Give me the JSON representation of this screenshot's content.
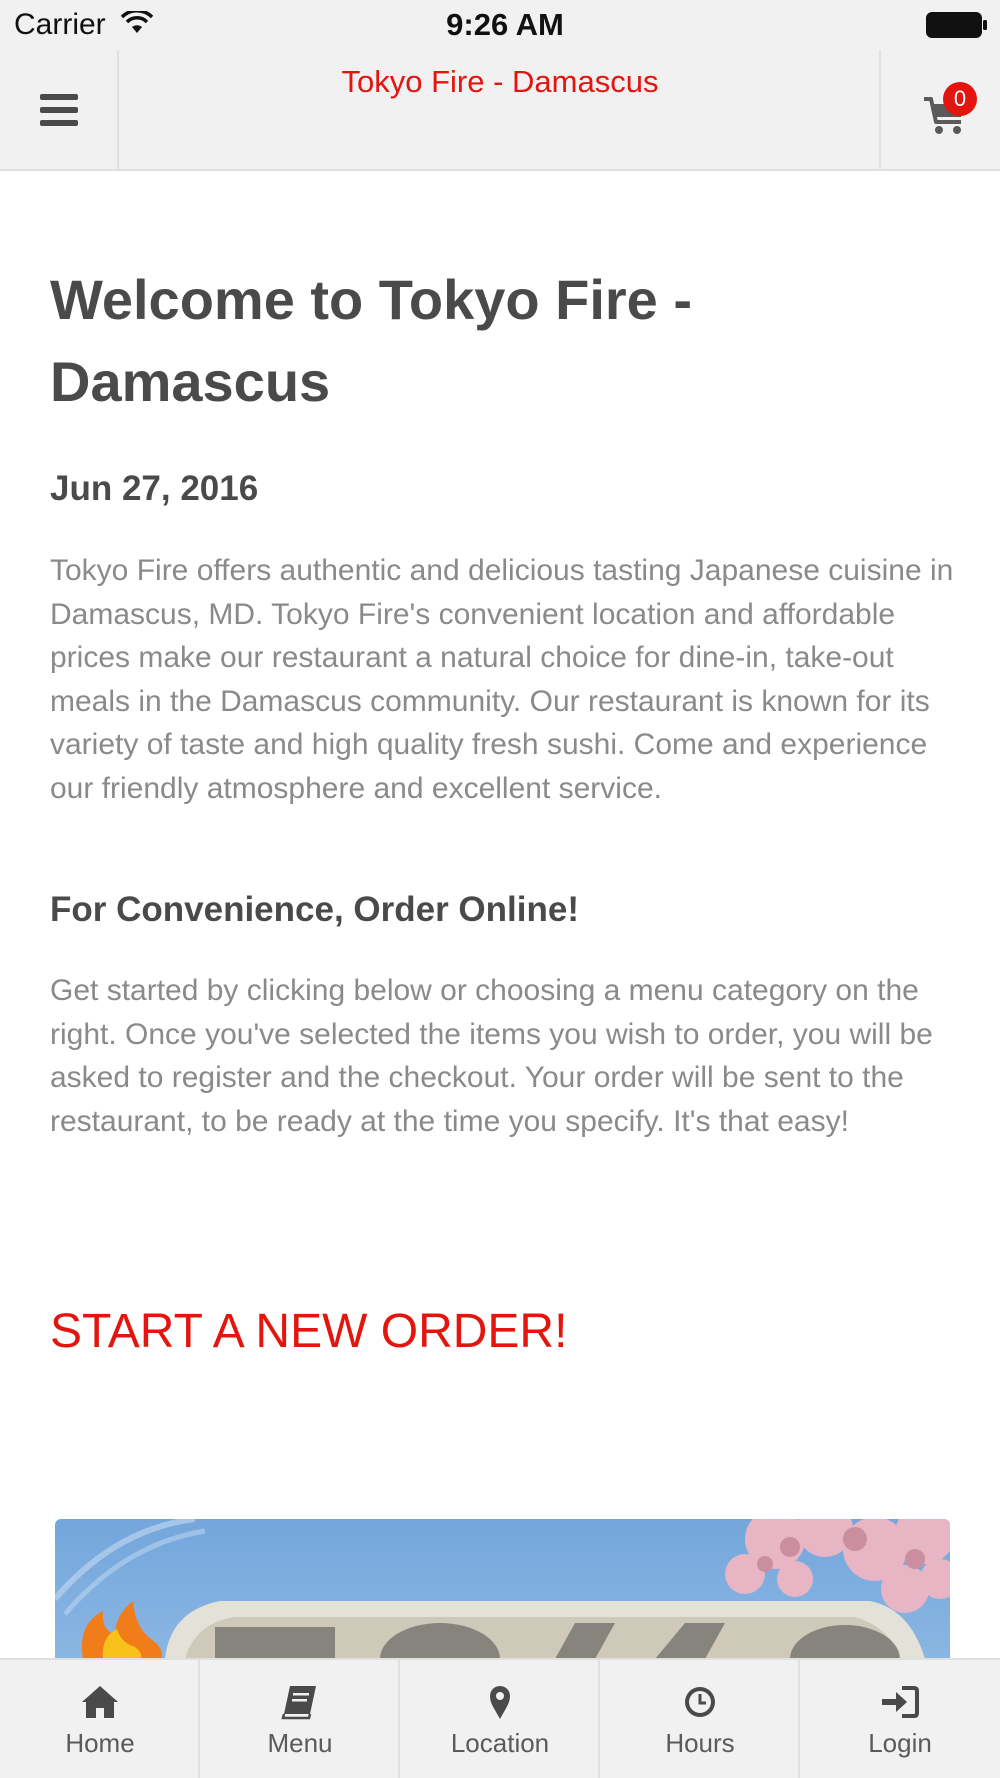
{
  "status_bar": {
    "carrier": "Carrier",
    "time": "9:26 AM"
  },
  "header": {
    "title": "Tokyo Fire - Damascus",
    "cart_count": "0",
    "menu_icon": "hamburger-menu-icon",
    "cart_icon": "shopping-cart-icon"
  },
  "main": {
    "welcome_heading": "Welcome to Tokyo Fire - Damascus",
    "date": "Jun 27, 2016",
    "intro": "Tokyo Fire offers authentic and delicious tasting Japanese cuisine in Damascus, MD. Tokyo Fire's convenient location and affordable prices make our restaurant a natural choice for dine-in, take-out meals in the Damascus community. Our restaurant is known for its variety of taste and high quality fresh sushi. Come and experience our friendly atmosphere and excellent service.",
    "order_heading": "For Convenience, Order Online!",
    "order_text": "Get started by clicking below or choosing a menu category on the right. Once you've selected the items you wish to order, you will be asked to register and the checkout. Your order will be sent to the restaurant, to be ready at the time you specify. It's that easy!",
    "start_order": "START A NEW ORDER!"
  },
  "tabs": [
    {
      "label": "Home",
      "icon": "home-icon"
    },
    {
      "label": "Menu",
      "icon": "book-icon"
    },
    {
      "label": "Location",
      "icon": "map-marker-icon"
    },
    {
      "label": "Hours",
      "icon": "clock-icon"
    },
    {
      "label": "Login",
      "icon": "sign-in-icon"
    }
  ],
  "colors": {
    "accent": "#e2150f",
    "header_bg": "#f1f1f1",
    "heading_text": "#4a4a4a",
    "body_text": "#8a8a8a"
  }
}
